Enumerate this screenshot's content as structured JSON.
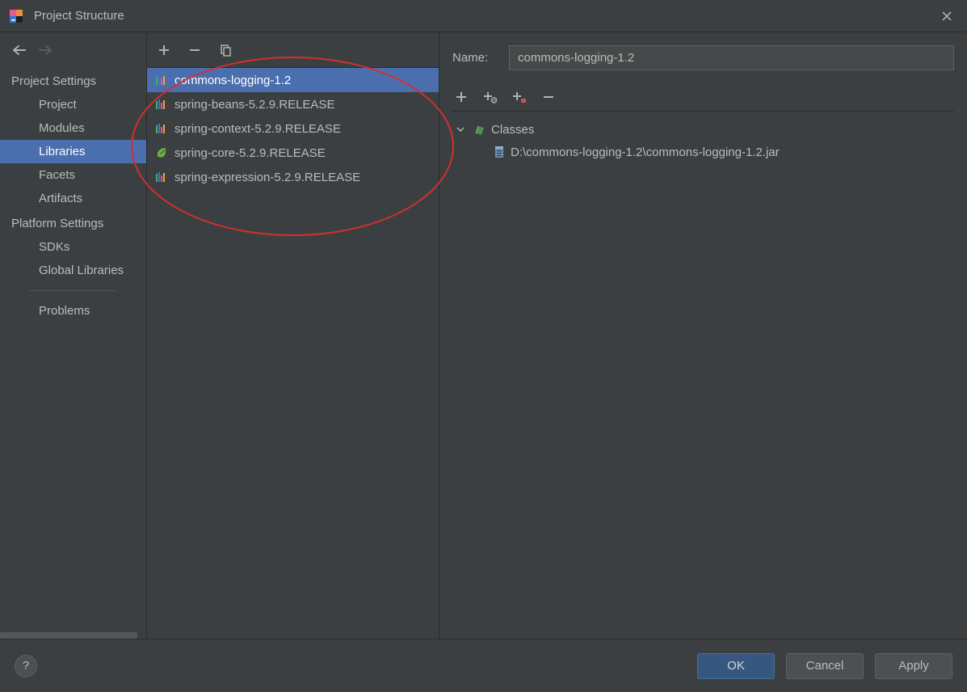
{
  "window": {
    "title": "Project Structure"
  },
  "nav": {
    "sections": [
      {
        "label": "Project Settings",
        "items": [
          "Project",
          "Modules",
          "Libraries",
          "Facets",
          "Artifacts"
        ],
        "selected": "Libraries"
      },
      {
        "label": "Platform Settings",
        "items": [
          "SDKs",
          "Global Libraries"
        ]
      }
    ],
    "bottom_item": "Problems"
  },
  "libraries": {
    "items": [
      {
        "name": "commons-logging-1.2",
        "icon": "bars-multi",
        "selected": true
      },
      {
        "name": "spring-beans-5.2.9.RELEASE",
        "icon": "bars-multi"
      },
      {
        "name": "spring-context-5.2.9.RELEASE",
        "icon": "bars-multi"
      },
      {
        "name": "spring-core-5.2.9.RELEASE",
        "icon": "leaf"
      },
      {
        "name": "spring-expression-5.2.9.RELEASE",
        "icon": "bars-multi"
      }
    ]
  },
  "detail": {
    "name_label": "Name:",
    "name_value": "commons-logging-1.2",
    "tree": {
      "root_label": "Classes",
      "entry": "D:\\commons-logging-1.2\\commons-logging-1.2.jar"
    }
  },
  "footer": {
    "ok": "OK",
    "cancel": "Cancel",
    "apply": "Apply"
  }
}
